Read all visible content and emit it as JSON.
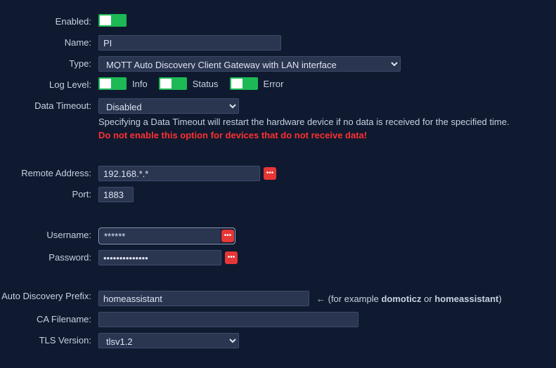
{
  "labels": {
    "enabled": "Enabled:",
    "name": "Name:",
    "type": "Type:",
    "loglevel": "Log Level:",
    "datatimeout": "Data Timeout:",
    "remoteaddr": "Remote Address:",
    "port": "Port:",
    "username": "Username:",
    "password": "Password:",
    "prefix": "Auto Discovery Prefix:",
    "cafile": "CA Filename:",
    "tls": "TLS Version:"
  },
  "values": {
    "name": "PI",
    "type": "MQTT Auto Discovery Client Gateway with LAN interface",
    "datatimeout": "Disabled",
    "remoteaddr": "192.168.*.*",
    "port": "1883",
    "username": "******",
    "password": "••••••••••••••",
    "prefix": "homeassistant",
    "cafile": "",
    "tls": "tlsv1.2"
  },
  "loglevel": {
    "info": "Info",
    "status": "Status",
    "error": "Error"
  },
  "datatimeout_help": "Specifying a Data Timeout will restart the hardware device if no data is received for the specified time.",
  "datatimeout_warn": "Do not enable this option for devices that do not receive data!",
  "prefix_hint_pre": "← (for example ",
  "prefix_hint_a": "domoticz",
  "prefix_hint_mid": " or ",
  "prefix_hint_b": "homeassistant",
  "prefix_hint_post": ")"
}
